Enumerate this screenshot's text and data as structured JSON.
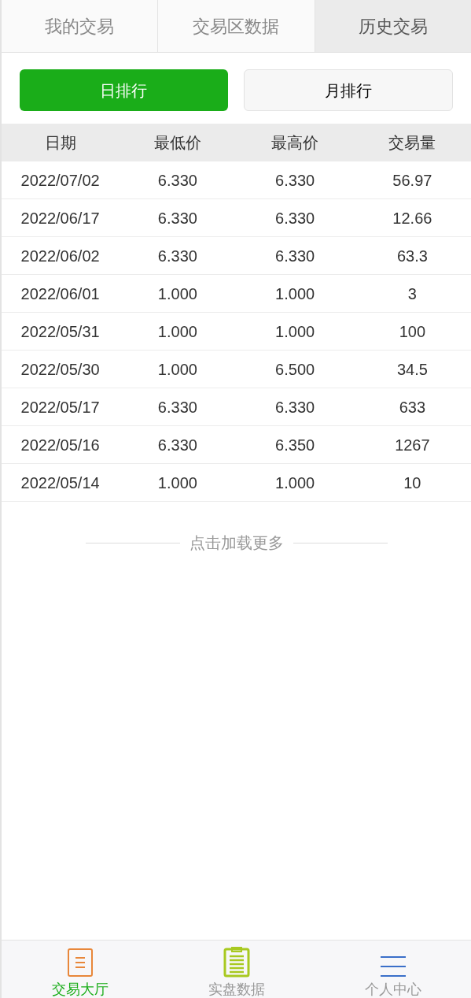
{
  "tabs": [
    {
      "label": "我的交易",
      "selected": false
    },
    {
      "label": "交易区数据",
      "selected": false
    },
    {
      "label": "历史交易",
      "selected": true
    }
  ],
  "ranking_buttons": [
    {
      "label": "日排行",
      "selected": true
    },
    {
      "label": "月排行",
      "selected": false
    }
  ],
  "table": {
    "columns": [
      "日期",
      "最低价",
      "最高价",
      "交易量"
    ],
    "rows": [
      [
        "2022/07/02",
        "6.330",
        "6.330",
        "56.97"
      ],
      [
        "2022/06/17",
        "6.330",
        "6.330",
        "12.66"
      ],
      [
        "2022/06/02",
        "6.330",
        "6.330",
        "63.3"
      ],
      [
        "2022/06/01",
        "1.000",
        "1.000",
        "3"
      ],
      [
        "2022/05/31",
        "1.000",
        "1.000",
        "100"
      ],
      [
        "2022/05/30",
        "1.000",
        "6.500",
        "34.5"
      ],
      [
        "2022/05/17",
        "6.330",
        "6.330",
        "633"
      ],
      [
        "2022/05/16",
        "6.330",
        "6.350",
        "1267"
      ],
      [
        "2022/05/14",
        "1.000",
        "1.000",
        "10"
      ]
    ]
  },
  "load_more": "点击加载更多",
  "bottom_nav": [
    {
      "label": "交易大厅",
      "selected": true,
      "kind": "document",
      "color": "#e8873a"
    },
    {
      "label": "实盘数据",
      "selected": false,
      "kind": "clipboard",
      "color": "#a8c920"
    },
    {
      "label": "个人中心",
      "selected": false,
      "kind": "menu",
      "color": "#3a6fc9"
    }
  ]
}
